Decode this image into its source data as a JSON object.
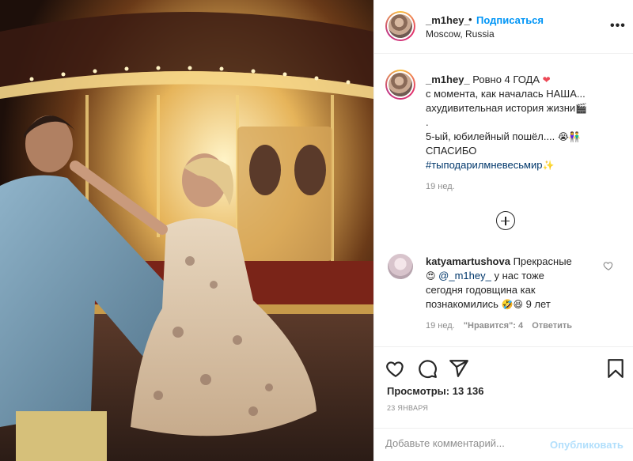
{
  "post": {
    "author": "_m1hey_",
    "dot": "•",
    "follow_label": "Подписаться",
    "location": "Moscow, Russia",
    "more_label": "•••"
  },
  "caption": {
    "author": "_m1hey_",
    "line1_text": "Ровно 4 ГОДА",
    "line1_emoji": "❤",
    "line2": "с момента, как началась НАША...",
    "line3_text": "ахудивительная история жизни",
    "line3_emoji": "🎬",
    "line4": ".",
    "line5_text": "5-ый, юбилейный пошёл....",
    "line5_emoji": "😭👫",
    "line6": "СПАСИБО",
    "hashtag": "#тыподарилмневесьмир",
    "hashtag_emoji": "✨",
    "time": "19 нед."
  },
  "comment": {
    "author": "katyamartushova",
    "text_a": "Прекрасные",
    "emoji_a": "😍",
    "mention": "@_m1hey_",
    "text_b": "у нас тоже",
    "line3": "сегодня годовщина как",
    "line4_text": "познакомились",
    "emoji_b": "🤣😆",
    "line4_end": "9 лет",
    "time": "19 нед.",
    "likes": "\"Нравится\": 4",
    "reply": "Ответить"
  },
  "stats": {
    "views_label": "Просмотры:",
    "views_count": "13 136",
    "date": "23 ЯНВАРЯ"
  },
  "add_comment": {
    "placeholder": "Добавьте комментарий...",
    "publish_label": "Опубликовать"
  },
  "icons": {
    "like": "heart-icon",
    "comment": "comment-icon",
    "share": "share-icon",
    "save": "bookmark-icon",
    "load_more": "plus-circle-icon",
    "comment_like": "heart-icon"
  },
  "colors": {
    "link_blue": "#0095f6",
    "hashtag_blue": "#00376b",
    "muted": "#8e8e8e",
    "publish_disabled": "#b2dffc",
    "heart_red": "#ed4956"
  }
}
